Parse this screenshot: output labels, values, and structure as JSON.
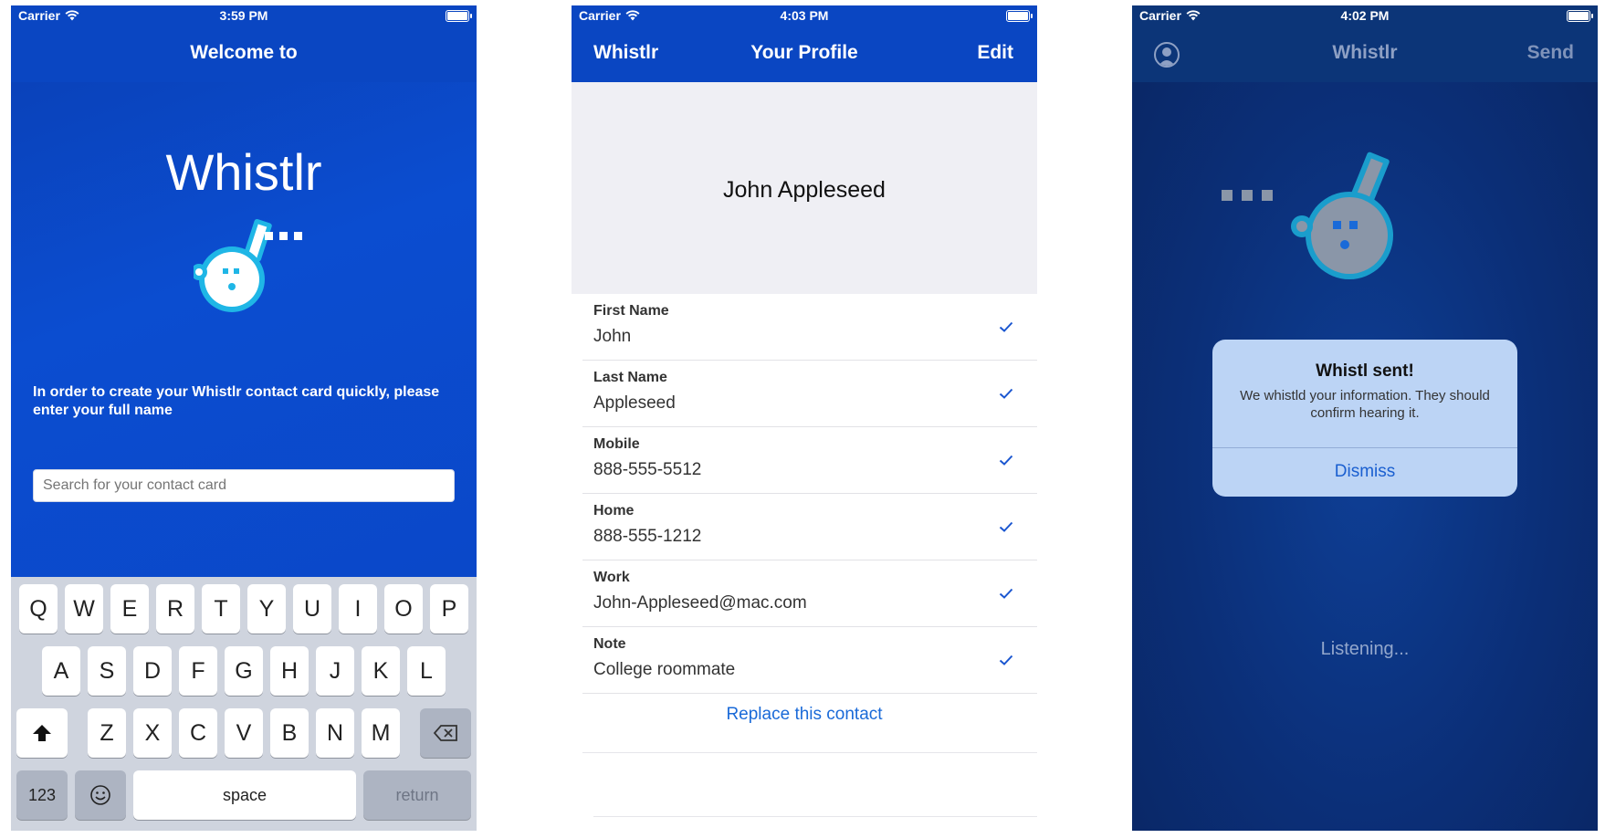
{
  "screen1": {
    "status": {
      "carrier": "Carrier",
      "time": "3:59 PM"
    },
    "nav_title": "Welcome to",
    "brand": "Whistlr",
    "instruction": "In order to create your Whistlr contact card quickly, please enter your full name",
    "search_placeholder": "Search for your contact card",
    "keyboard": {
      "row1": [
        "Q",
        "W",
        "E",
        "R",
        "T",
        "Y",
        "U",
        "I",
        "O",
        "P"
      ],
      "row2": [
        "A",
        "S",
        "D",
        "F",
        "G",
        "H",
        "J",
        "K",
        "L"
      ],
      "row3": [
        "Z",
        "X",
        "C",
        "V",
        "B",
        "N",
        "M"
      ],
      "numbers": "123",
      "space": "space",
      "return": "return"
    }
  },
  "screen2": {
    "status": {
      "carrier": "Carrier",
      "time": "4:03 PM"
    },
    "nav_left": "Whistlr",
    "nav_title": "Your Profile",
    "nav_right": "Edit",
    "profile_name": "John Appleseed",
    "fields": [
      {
        "label": "First Name",
        "value": "John"
      },
      {
        "label": "Last Name",
        "value": "Appleseed"
      },
      {
        "label": "Mobile",
        "value": "888-555-5512"
      },
      {
        "label": "Home",
        "value": "888-555-1212"
      },
      {
        "label": "Work",
        "value": "John-Appleseed@mac.com"
      },
      {
        "label": "Note",
        "value": "College roommate"
      }
    ],
    "replace_label": "Replace this contact"
  },
  "screen3": {
    "status": {
      "carrier": "Carrier",
      "time": "4:02 PM"
    },
    "nav_title": "Whistlr",
    "nav_right": "Send",
    "alert": {
      "title": "Whistl sent!",
      "message": "We whistld your information. They should confirm hearing it.",
      "button": "Dismiss"
    },
    "listening": "Listening..."
  },
  "colors": {
    "primary": "#0a46c2",
    "accent": "#1a6ad8",
    "mascot": "#1fb6e6",
    "dark_bg": "#0b2f78"
  }
}
